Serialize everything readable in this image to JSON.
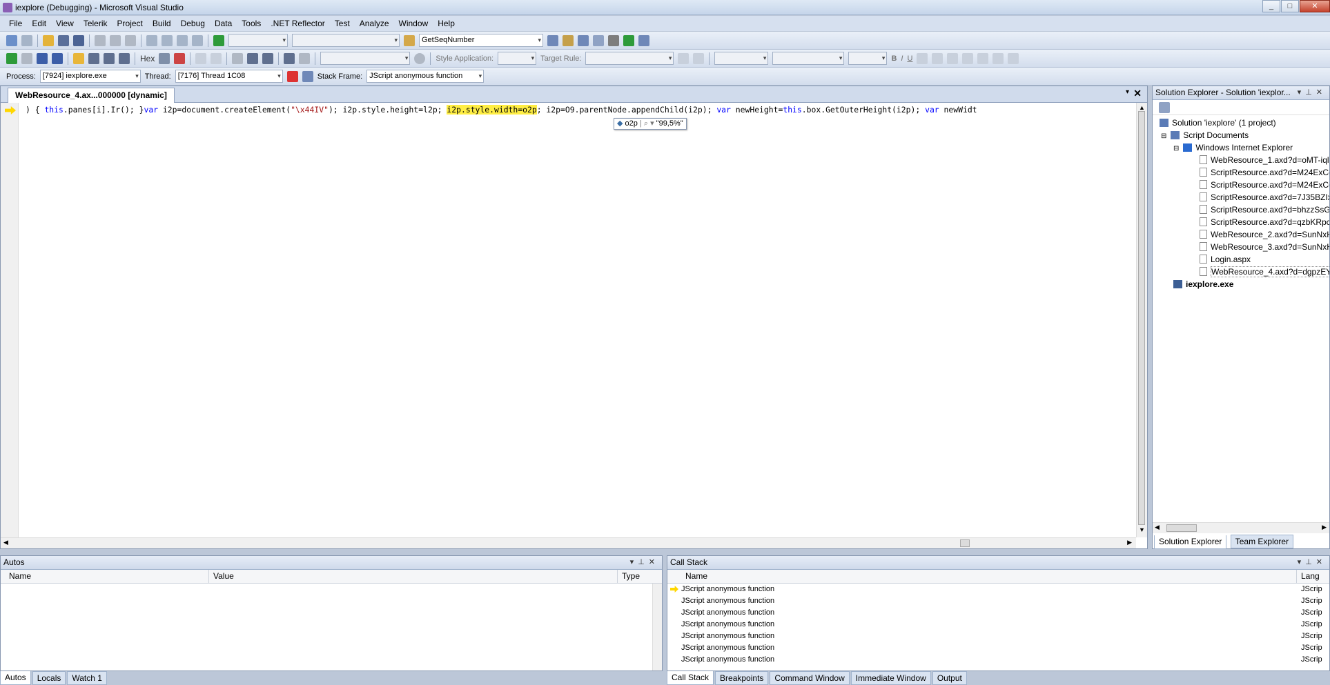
{
  "window": {
    "title": "iexplore (Debugging) - Microsoft Visual Studio",
    "min": "_",
    "max": "□",
    "close": "✕"
  },
  "menu": [
    "File",
    "Edit",
    "View",
    "Telerik",
    "Project",
    "Build",
    "Debug",
    "Data",
    "Tools",
    ".NET Reflector",
    "Test",
    "Analyze",
    "Window",
    "Help"
  ],
  "toolbar1": {
    "function_combo": "GetSeqNumber"
  },
  "toolbar2": {
    "hex_label": "Hex",
    "style_app_label": "Style Application:",
    "target_rule_label": "Target Rule:",
    "bold": "B",
    "italic": "I",
    "underline": "U"
  },
  "toolbar3": {
    "process_label": "Process:",
    "process_value": "[7924] iexplore.exe",
    "thread_label": "Thread:",
    "thread_value": "[7176] Thread 1C08",
    "stackframe_label": "Stack Frame:",
    "stackframe_value": "JScript anonymous function"
  },
  "editor": {
    "tab_label": "WebResource_4.ax...000000 [dynamic]",
    "code_parts": [
      ") { ",
      "this",
      ".panes[i].Ir(); }",
      "var",
      " i2p=document.createElement(",
      "\"\\x44IV\"",
      "); i2p.style.height=l2p; ",
      "i2p.style.width=o2p",
      "; i2p=O9.parentNode.appendChild(i2p); ",
      "var",
      " newHeight=",
      "this",
      ".box.GetOuterHeight(i2p); ",
      "var",
      " newWidt"
    ],
    "tooltip_name": "o2p",
    "tooltip_value": "\"99,5%\""
  },
  "solution_explorer": {
    "title": "Solution Explorer - Solution 'iexplor...",
    "solution": "Solution 'iexplore' (1 project)",
    "script_documents": "Script Documents",
    "browser": "Windows Internet Explorer",
    "files": [
      "WebResource_1.axd?d=oMT-iql",
      "ScriptResource.axd?d=M24ExCo",
      "ScriptResource.axd?d=M24ExCo",
      "ScriptResource.axd?d=7J35BZIx0",
      "ScriptResource.axd?d=bhzzSsG4",
      "ScriptResource.axd?d=qzbKRpc",
      "WebResource_2.axd?d=SunNxH",
      "WebResource_3.axd?d=SunNxH",
      "Login.aspx",
      "WebResource_4.axd?d=dgpzEYI"
    ],
    "exe": "iexplore.exe",
    "tabs": [
      "Solution Explorer",
      "Team Explorer"
    ]
  },
  "autos": {
    "title": "Autos",
    "columns": [
      "Name",
      "Value",
      "Type"
    ],
    "tabs": [
      "Autos",
      "Locals",
      "Watch 1"
    ]
  },
  "callstack": {
    "title": "Call Stack",
    "columns": [
      "Name",
      "Lang"
    ],
    "rows": [
      {
        "name": "JScript anonymous function",
        "lang": "JScrip"
      },
      {
        "name": "JScript anonymous function",
        "lang": "JScrip"
      },
      {
        "name": "JScript anonymous function",
        "lang": "JScrip"
      },
      {
        "name": "JScript anonymous function",
        "lang": "JScrip"
      },
      {
        "name": "JScript anonymous function",
        "lang": "JScrip"
      },
      {
        "name": "JScript anonymous function",
        "lang": "JScrip"
      },
      {
        "name": "JScript anonymous function",
        "lang": "JScrip"
      }
    ],
    "tabs": [
      "Call Stack",
      "Breakpoints",
      "Command Window",
      "Immediate Window",
      "Output"
    ]
  }
}
